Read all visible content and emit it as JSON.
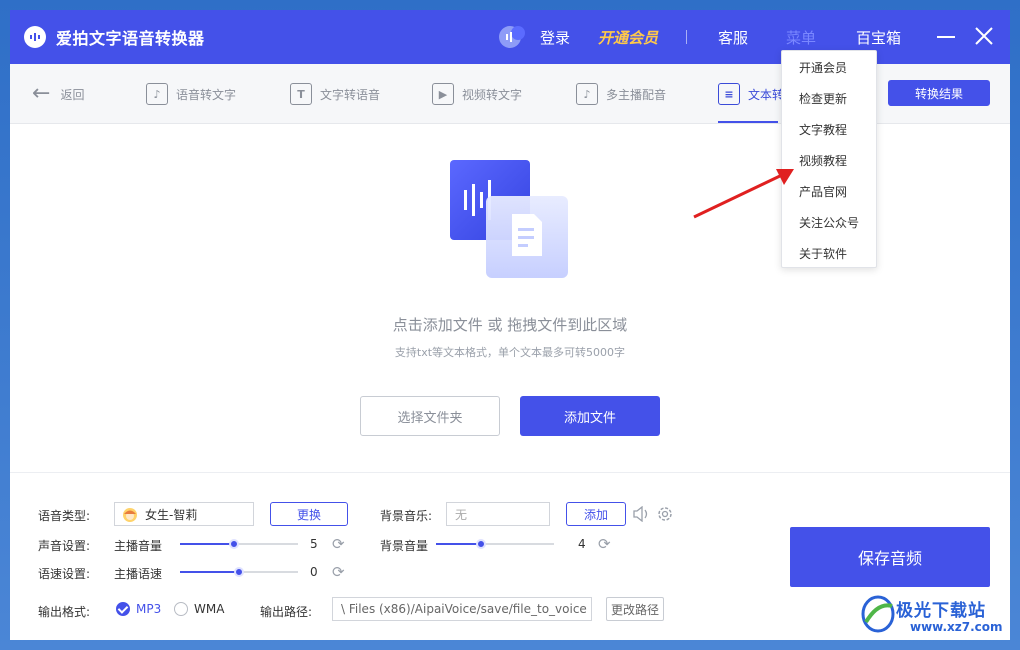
{
  "app": {
    "title": "爱拍文字语音转换器"
  },
  "titlebar": {
    "login": "登录",
    "vip": "开通会员",
    "service": "客服",
    "menu": "菜单",
    "toolbox": "百宝箱"
  },
  "tabs": {
    "back": "返回",
    "items": [
      {
        "label": "语音转文字",
        "icon": "microphone-doc-icon"
      },
      {
        "label": "文字转语音",
        "icon": "text-t-icon"
      },
      {
        "label": "视频转文字",
        "icon": "video-icon"
      },
      {
        "label": "多主播配音",
        "icon": "multi-mic-icon"
      },
      {
        "label": "文本转",
        "icon": "doc-audio-icon"
      }
    ],
    "result_button": "转换结果"
  },
  "drop": {
    "title": "点击添加文件 或 拖拽文件到此区域",
    "subtitle": "支持txt等文本格式，单个文本最多可转5000字",
    "folder_button": "选择文件夹",
    "add_button": "添加文件"
  },
  "settings": {
    "voice_type_label": "语音类型:",
    "voice_name": "女生-智莉",
    "change_button": "更换",
    "bg_music_label": "背景音乐:",
    "bg_music_placeholder": "无",
    "add_button": "添加",
    "sound_label": "声音设置:",
    "anchor_volume_label": "主播音量",
    "anchor_volume_value": "5",
    "anchor_volume_level": 0.46,
    "bg_volume_label": "背景音量",
    "bg_volume_value": "4",
    "bg_volume_level": 0.38,
    "speed_label": "语速设置:",
    "anchor_speed_label": "主播语速",
    "anchor_speed_value": "0",
    "anchor_speed_level": 0.5,
    "format_label": "输出格式:",
    "format_mp3": "MP3",
    "format_wma": "WMA",
    "format_selected": "MP3",
    "path_label": "输出路径:",
    "path_value": "\\ Files (x86)/AipaiVoice/save/file_to_voice",
    "change_path_button": "更改路径",
    "save_button": "保存音频"
  },
  "menu": {
    "items": [
      "开通会员",
      "检查更新",
      "文字教程",
      "视频教程",
      "产品官网",
      "关注公众号",
      "关于软件"
    ]
  },
  "watermark": {
    "name": "极光下载站",
    "url": "www.xz7.com"
  },
  "colors": {
    "primary": "#4451e9",
    "vip": "#ffc94a",
    "annotation": "#e02020"
  }
}
